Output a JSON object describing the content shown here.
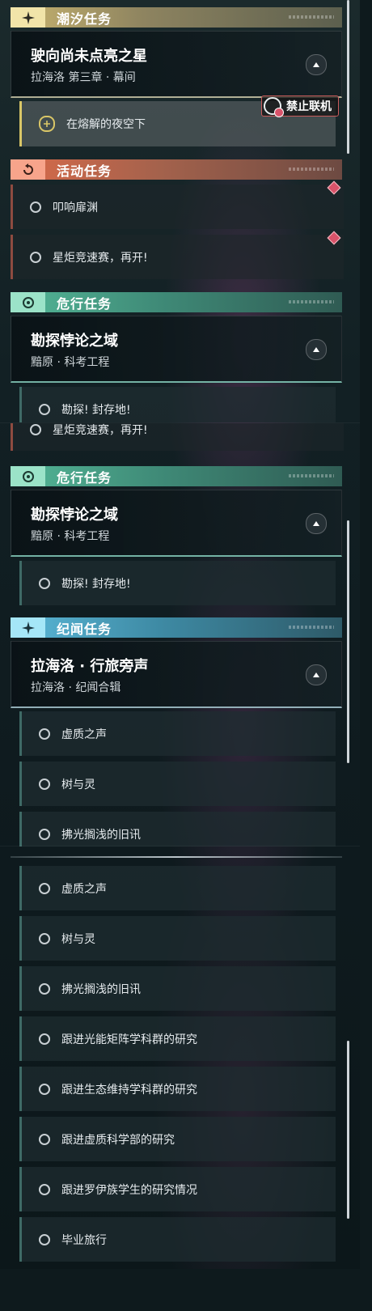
{
  "panel1": {
    "tide_header": "潮汐任务",
    "tide_card": {
      "title": "驶向尚未点亮之星",
      "subtitle": "拉海洛 第三章 · 幕间"
    },
    "active_objective": "在熔解的夜空下",
    "pvp_badge": "禁止联机",
    "event_header": "活动任务",
    "event_objectives": [
      "叩响扉渊",
      "星炬竞速赛，再开!"
    ],
    "danger_header": "危行任务",
    "danger_card": {
      "title": "勘探悖论之域",
      "subtitle": "黯原 · 科考工程"
    },
    "cut_objective": "勘探! 封存地!"
  },
  "panel2": {
    "cut_objective": "星炬竞速赛，再开!",
    "danger_header": "危行任务",
    "danger_card": {
      "title": "勘探悖论之域",
      "subtitle": "黯原 · 科考工程"
    },
    "danger_objective": "勘探! 封存地!",
    "chronicle_header": "纪闻任务",
    "chronicle_card": {
      "title": "拉海洛 · 行旅旁声",
      "subtitle": "拉海洛 · 纪闻合辑"
    },
    "chronicle_objectives": [
      "虚质之声",
      "树与灵"
    ],
    "cut_objective2": "拂光搁浅的旧讯"
  },
  "panel3": {
    "objectives": [
      "虚质之声",
      "树与灵",
      "拂光搁浅的旧讯",
      "跟进光能矩阵学科群的研究",
      "跟进生态维持学科群的研究",
      "跟进虚质科学部的研究",
      "跟进罗伊族学生的研究情况",
      "毕业旅行"
    ]
  },
  "colors": {
    "tide": "#c8b46f",
    "event": "#d96a4a",
    "danger": "#53b797",
    "chronicle": "#5bb8d8",
    "alert": "#d9536a"
  },
  "icons": {
    "tide": "sparkle-icon",
    "event": "refresh-icon",
    "danger": "hazard-eye-icon",
    "chronicle": "sparkle-icon",
    "expand": "chevron-up-icon",
    "pvp": "no-coop-icon"
  }
}
